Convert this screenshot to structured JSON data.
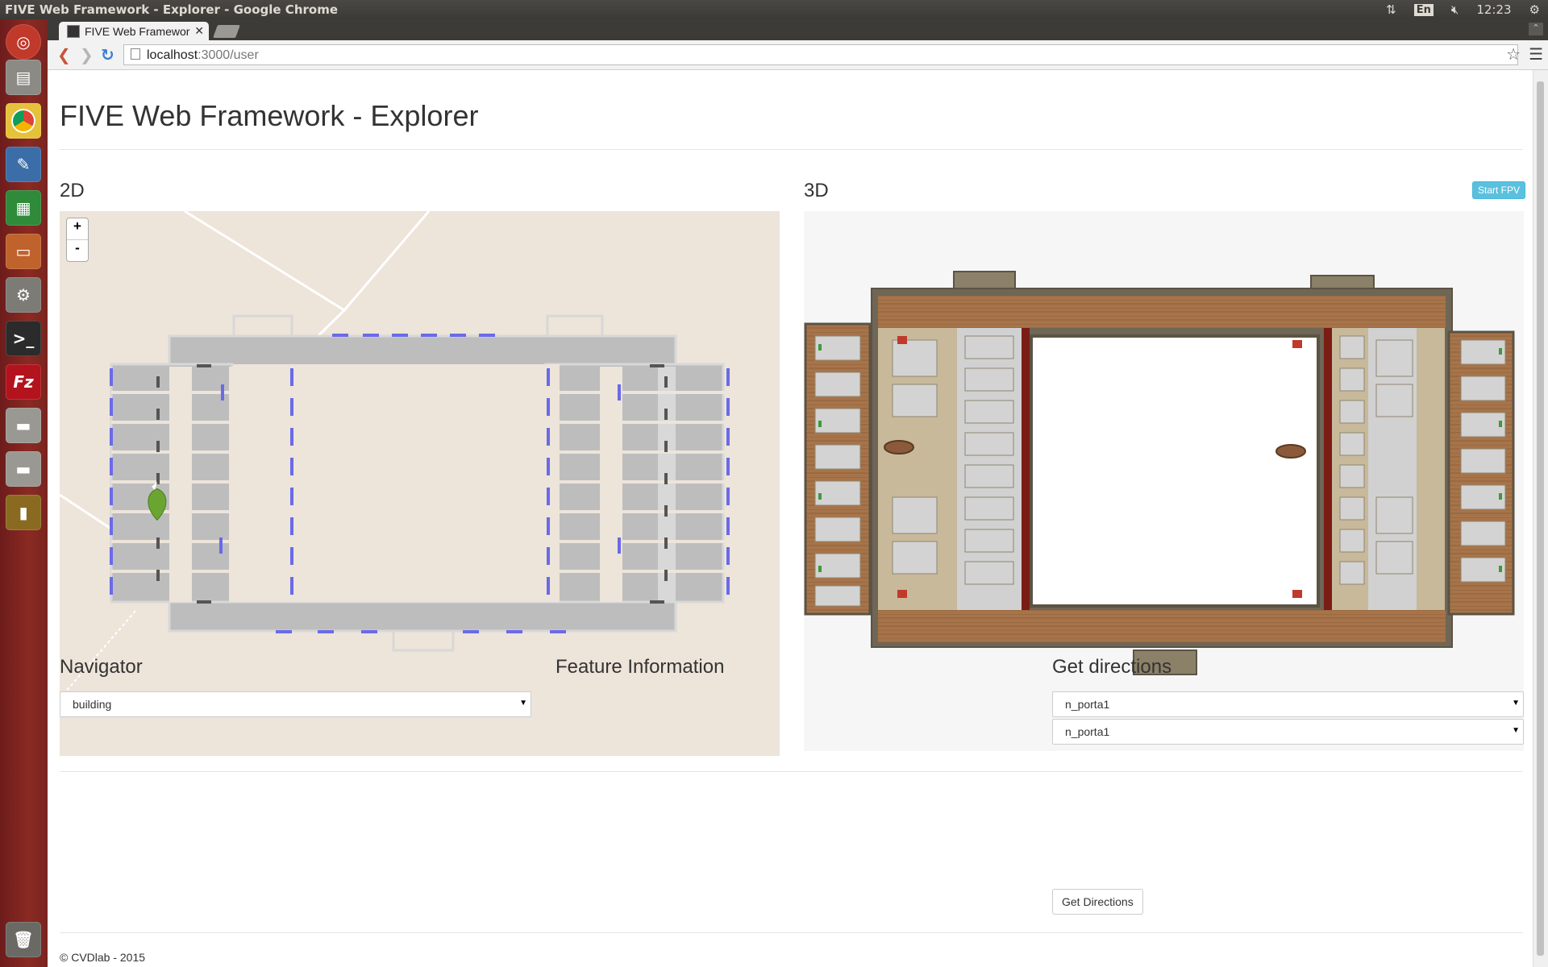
{
  "system": {
    "window_title": "FIVE Web Framework - Explorer - Google Chrome",
    "keyboard_layout": "En",
    "clock": "12:23"
  },
  "launcher": [
    "ubuntu-dash-icon",
    "files-icon",
    "chrome-icon",
    "writer-icon",
    "calc-icon",
    "impress-icon",
    "settings-icon",
    "terminal-icon",
    "filezilla-icon",
    "drive-icon",
    "drive-icon",
    "usb-drive-icon",
    "trash-icon"
  ],
  "browser": {
    "tab_title": "FIVE Web Framewor",
    "url_host": "localhost",
    "url_path": ":3000/user"
  },
  "page": {
    "title": "FIVE Web Framework - Explorer",
    "panel_2d": "2D",
    "panel_3d": "3D",
    "start_fpv": "Start FPV",
    "zoom_in": "+",
    "zoom_out": "-",
    "navigator": {
      "heading": "Navigator",
      "selected": "building"
    },
    "feature_info": {
      "heading": "Feature Information"
    },
    "directions": {
      "heading": "Get directions",
      "from": "n_porta1",
      "to": "n_porta1",
      "button": "Get Directions"
    },
    "footer": "© CVDlab - 2015"
  },
  "colors": {
    "map_background": "#ede4da",
    "room_fill": "#bdbdbd",
    "door_marker": "#6a6ae8",
    "marker": "#6aa531",
    "fpv_button": "#5bc0de",
    "launcher": "#7a2420"
  }
}
